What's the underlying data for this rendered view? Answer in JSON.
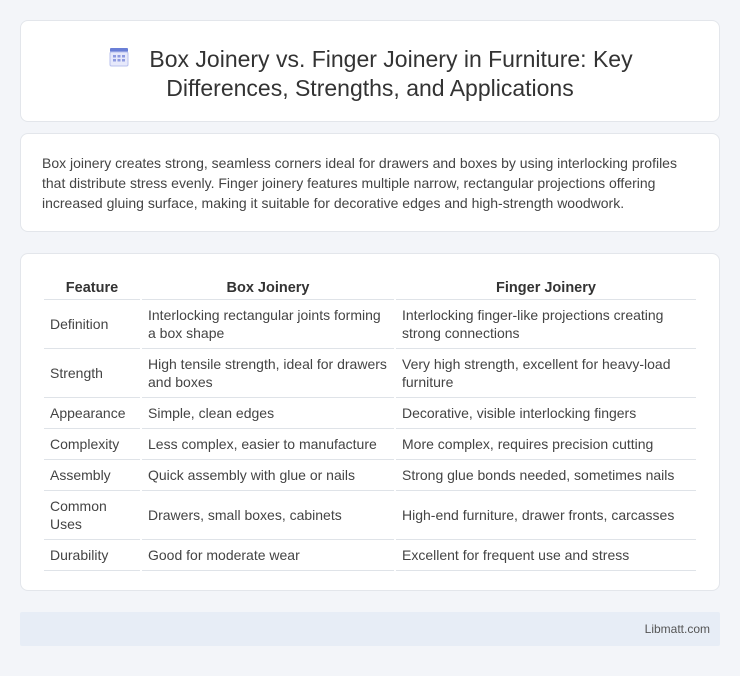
{
  "header": {
    "title_line1": "Box Joinery vs. Finger Joinery in Furniture: Key",
    "title_line2": "Differences, Strengths, and Applications",
    "icon": "calendar-icon",
    "accent_color": "#6a7fd6"
  },
  "intro": {
    "text": "Box joinery creates strong, seamless corners ideal for drawers and boxes by using interlocking profiles that distribute stress evenly. Finger joinery features multiple narrow, rectangular projections offering increased gluing surface, making it suitable for decorative edges and high-strength woodwork."
  },
  "table": {
    "headers": [
      "Feature",
      "Box Joinery",
      "Finger Joinery"
    ],
    "rows": [
      [
        "Definition",
        "Interlocking rectangular joints forming a box shape",
        "Interlocking finger-like projections creating strong connections"
      ],
      [
        "Strength",
        "High tensile strength, ideal for drawers and boxes",
        "Very high strength, excellent for heavy-load furniture"
      ],
      [
        "Appearance",
        "Simple, clean edges",
        "Decorative, visible interlocking fingers"
      ],
      [
        "Complexity",
        "Less complex, easier to manufacture",
        "More complex, requires precision cutting"
      ],
      [
        "Assembly",
        "Quick assembly with glue or nails",
        "Strong glue bonds needed, sometimes nails"
      ],
      [
        "Common Uses",
        "Drawers, small boxes, cabinets",
        "High-end furniture, drawer fronts, carcasses"
      ],
      [
        "Durability",
        "Good for moderate wear",
        "Excellent for frequent use and stress"
      ]
    ]
  },
  "footer": {
    "source": "Libmatt.com"
  }
}
